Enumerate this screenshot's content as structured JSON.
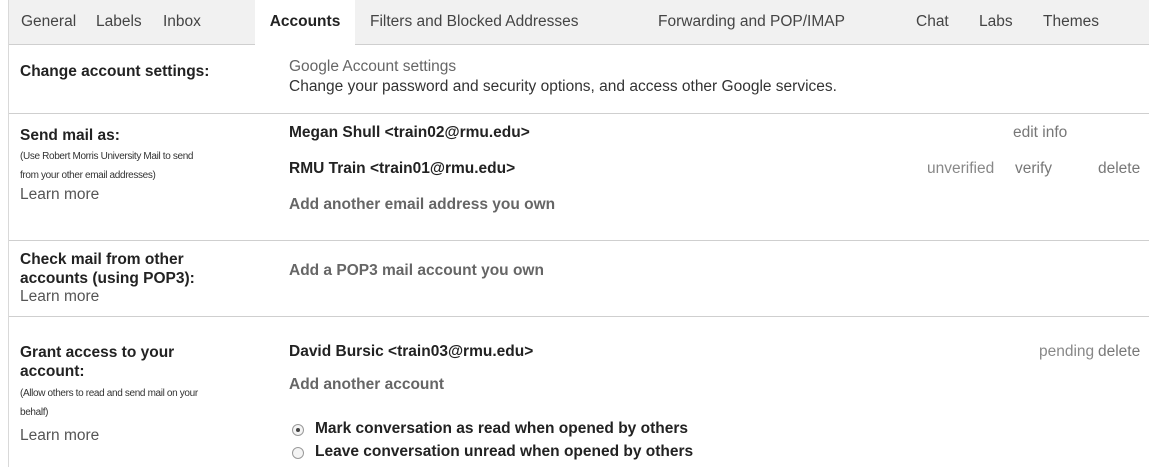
{
  "tabs": [
    "General",
    "Labels",
    "Inbox",
    "Accounts",
    "Filters and Blocked Addresses",
    "Forwarding and POP/IMAP",
    "Chat",
    "Labs",
    "Themes"
  ],
  "active_tab": "Accounts",
  "change_account": {
    "title": "Change account settings:",
    "link": "Google Account settings",
    "description": "Change your password and security options, and access other Google services."
  },
  "send_mail": {
    "title": "Send mail as:",
    "note_line1": "(Use Robert Morris University Mail to send",
    "note_line2": "from your other email addresses)",
    "learn_more": "Learn more",
    "accounts": [
      {
        "address": "Megan Shull <train02@rmu.edu>",
        "action": "edit info"
      },
      {
        "address": "RMU Train <train01@rmu.edu>",
        "status": "unverified",
        "action": "verify",
        "action2": "delete"
      }
    ],
    "add_link": "Add another email address you own"
  },
  "check_mail": {
    "title_line1": "Check mail from other",
    "title_line2": "accounts (using POP3):",
    "learn_more": "Learn more",
    "add_link": "Add a POP3 mail account you own"
  },
  "grant_access": {
    "title_line1": "Grant access to your",
    "title_line2": "account:",
    "note_line1": "(Allow others to read and send mail on your",
    "note_line2": "behalf)",
    "learn_more": "Learn more",
    "delegate": {
      "address": "David Bursic <train03@rmu.edu>",
      "status": "pending",
      "action": "delete"
    },
    "add_link": "Add another account",
    "options": [
      {
        "label": "Mark conversation as read when opened by others",
        "selected": true
      },
      {
        "label": "Leave conversation unread when opened by others",
        "selected": false
      }
    ]
  }
}
